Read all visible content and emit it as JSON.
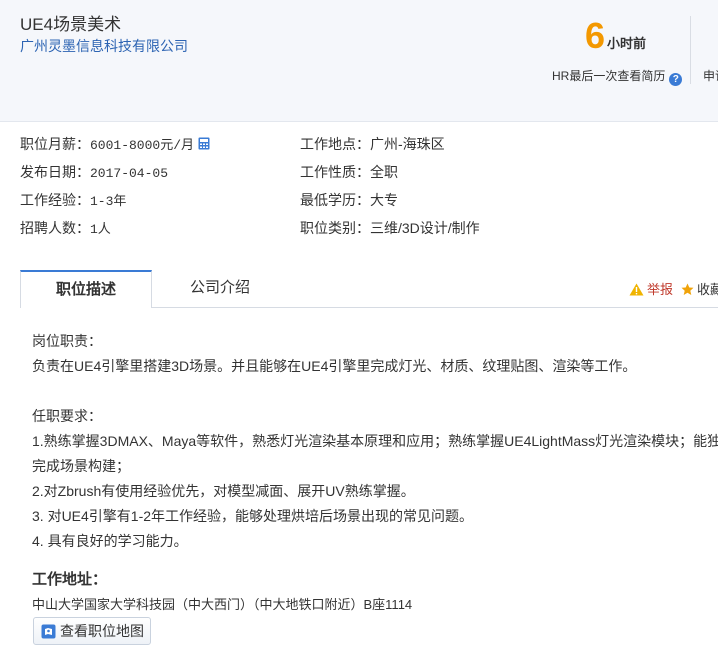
{
  "header": {
    "job_title": "UE4场景美术",
    "company": "广州灵墨信息科技有限公司",
    "hr_number": "6",
    "hr_unit": "小时前",
    "hr_desc": "HR最后一次查看简历",
    "apply_partial": "申请"
  },
  "info": {
    "salary_label": "职位月薪：",
    "salary_value": "6001-8000元/月",
    "date_label": "发布日期：",
    "date_value": "2017-04-05",
    "exp_label": "工作经验：",
    "exp_value": "1-3年",
    "count_label": "招聘人数：",
    "count_value": "1人",
    "loc_label": "工作地点：",
    "loc_value": "广州-海珠区",
    "nature_label": "工作性质：",
    "nature_value": "全职",
    "edu_label": "最低学历：",
    "edu_value": "大专",
    "cat_label": "职位类别：",
    "cat_value": "三维/3D设计/制作"
  },
  "tabs": {
    "active": "职位描述",
    "second": "公司介绍",
    "report": "举报",
    "collect": "收藏"
  },
  "description": {
    "duty_title": "岗位职责：",
    "duty_line": "负责在UE4引擎里搭建3D场景。并且能够在UE4引擎里完成灯光、材质、纹理贴图、渲染等工作。",
    "req_title": "任职要求：",
    "req1a": "1.熟练掌握3DMAX、Maya等软件，熟悉灯光渲染基本原理和应用；熟练掌握UE4LightMass灯光渲染模块；能独立",
    "req1b": "完成场景构建；",
    "req2": "2.对Zbrush有使用经验优先，对模型减面、展开UV熟练掌握。",
    "req3": "3. 对UE4引擎有1-2年工作经验，能够处理烘培后场景出现的常见问题。",
    "req4": "4. 具有良好的学习能力。"
  },
  "address": {
    "title": "工作地址：",
    "value": "中山大学国家大学科技园（中大西门）（中大地铁口附近）B座1114",
    "map_button": "查看职位地图"
  },
  "colors": {
    "accent_blue": "#3a7bd5",
    "hr_orange": "#f39800",
    "company_blue": "#2d64b3",
    "report_red": "#c0392b"
  }
}
